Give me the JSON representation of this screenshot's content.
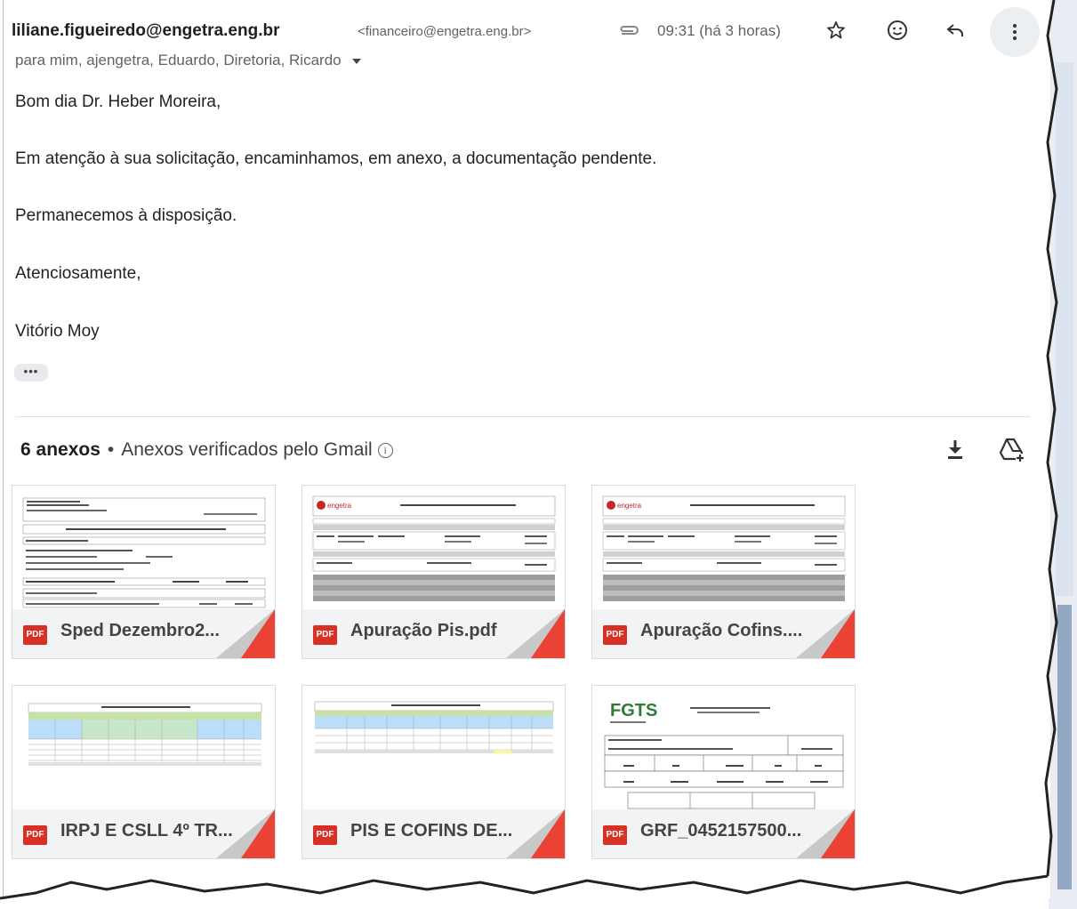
{
  "email": {
    "sender_name": "liliane.figueiredo@engetra.eng.br",
    "sender_email": "<financeiro@engetra.eng.br>",
    "time": "09:31 (há 3 horas)",
    "recipients": "para mim, ajengetra, Eduardo, Diretoria, Ricardo",
    "body": [
      "Bom dia Dr. Heber Moreira,",
      "Em atenção à sua solicitação, encaminhamos, em anexo, a documentação pendente.",
      "Permanecemos à disposição.",
      "Atenciosamente,",
      "Vitório Moy"
    ],
    "trimmed_label": "•••"
  },
  "attachments": {
    "count_label": "6 anexos",
    "separator": "•",
    "verified_label": "Anexos verificados pelo Gmail",
    "info_glyph": "i",
    "items": [
      {
        "name": "Sped Dezembro2...",
        "badge": "PDF",
        "thumb_type": "receipt"
      },
      {
        "name": "Apuração Pis.pdf",
        "badge": "PDF",
        "thumb_type": "engetra"
      },
      {
        "name": "Apuração Cofins....",
        "badge": "PDF",
        "thumb_type": "engetra"
      },
      {
        "name": "IRPJ E CSLL 4º TR...",
        "badge": "PDF",
        "thumb_type": "spreadsheet"
      },
      {
        "name": "PIS E COFINS DE...",
        "badge": "PDF",
        "thumb_type": "spreadsheet"
      },
      {
        "name": "GRF_0452157500...",
        "badge": "PDF",
        "thumb_type": "fgts"
      }
    ]
  },
  "thumbnails": {
    "engetra_logo": "engetra",
    "fgts_logo": "FGTS"
  },
  "colors": {
    "pdf_red": "#d93025",
    "corner_red": "#ea4335",
    "text_gray": "#5f6368",
    "card_bg": "#f1f3f4"
  },
  "icons": [
    "paperclip-icon",
    "star-icon",
    "smile-icon",
    "reply-icon",
    "more-vert-icon",
    "caret-down-icon",
    "info-icon",
    "download-icon",
    "drive-add-icon"
  ]
}
